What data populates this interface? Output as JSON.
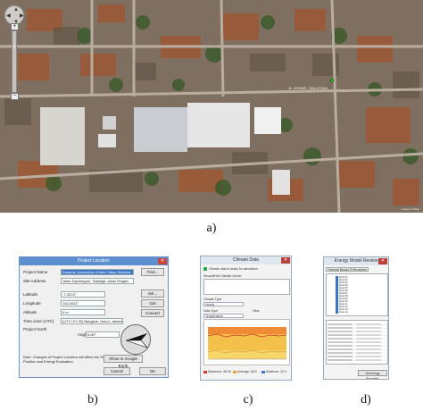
{
  "map": {
    "place_label": "JL.JOHAR, SALATIGA",
    "credit": "Imagery ©2014"
  },
  "captions": {
    "a": "a)",
    "b": "b)",
    "c": "c)",
    "d": "d)"
  },
  "project_location": {
    "title": "Project Location",
    "fields": [
      {
        "label": "Project Name",
        "value": "Kampus Universitas Kristen Satya Wacana",
        "selected": true
      },
      {
        "label": "Site Address",
        "value": "Jalan Diponegoro, Salatiga, Jawa Tengah",
        "selected": false
      },
      {
        "label": "Latitude",
        "value": "-7.3213°",
        "selected": false
      },
      {
        "label": "Longitude",
        "value": "110.5022°",
        "selected": false
      },
      {
        "label": "Altitude",
        "value": "0 m",
        "selected": false
      },
      {
        "label": "Time zone (UTC)",
        "value": "(UTC+07:00) Bangkok, Hanoi, Jakarta",
        "selected": false
      }
    ],
    "project_north_label": "Project North",
    "angle_label": "Angle",
    "angle_value": "0.00°",
    "side_buttons": [
      "Find...",
      "Set...",
      "Get",
      "Convert"
    ],
    "note": "Note: Changes of Project Location will affect the Sun Position and Energy Evaluation.",
    "bottom_buttons": [
      "Show In Google Earth",
      "Cancel",
      "OK"
    ]
  },
  "climate_data": {
    "title": "Climate Data",
    "checkbox_label": "Climate data is ready for simulation",
    "server_label": "StrusoftHub Climate Server",
    "climate_type_label": "Climate Type",
    "climate_type_value": "Hourly",
    "data_type_label": "Data Type",
    "data_type_value": "Temperature",
    "view_label": "View",
    "stats": [
      {
        "label": "Maximum",
        "value": "35.00",
        "color": "#d23a2a"
      },
      {
        "label": "Average",
        "value": "28.9",
        "color": "#e6a23c"
      },
      {
        "label": "Minimum",
        "value": "22.0",
        "color": "#3c78c8"
      }
    ]
  },
  "energy_browser": {
    "title": "Energy Model Review",
    "tabs": [
      "Thermal Blocks",
      "Structures"
    ],
    "tree_items": [
      "Zone 01",
      "Zone 02",
      "Zone 03",
      "Zone 04",
      "Zone 05",
      "Zone 06",
      "Zone 07",
      "Zone 08",
      "Zone 09",
      "Zone 10",
      "Zone 11",
      "Zone 12",
      "Zone 13",
      "Zone 14"
    ],
    "button_label": "Set Energy Properties"
  }
}
